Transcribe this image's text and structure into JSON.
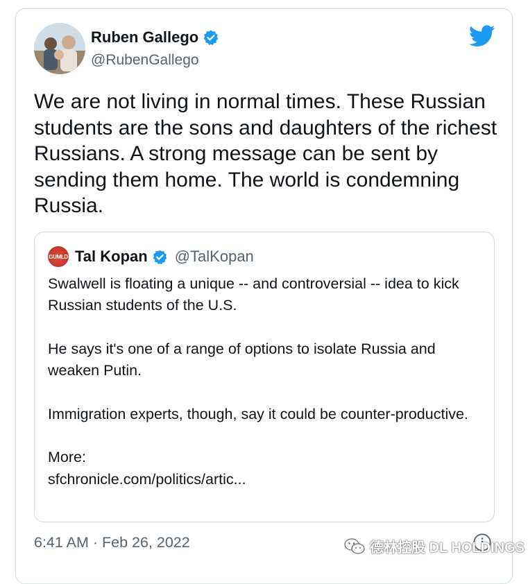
{
  "tweet": {
    "author_name": "Ruben Gallego",
    "author_handle": "@RubenGallego",
    "text": "We are not living in normal times. These Russian students are the sons and daughters of the richest Russians.  A strong message can be sent by sending them home. The world is condemning Russia.",
    "timestamp": "6:41 AM · Feb 26, 2022"
  },
  "quoted": {
    "avatar_text": "GUMLD",
    "author_name": "Tal Kopan",
    "author_handle": "@TalKopan",
    "paragraphs": [
      "Swalwell is floating a unique -- and controversial -- idea to kick Russian students of the U.S.",
      "He says it's one of a range of options to isolate Russia and weaken Putin.",
      "Immigration experts, though, say it could be counter-productive.",
      "More:",
      "sfchronicle.com/politics/artic..."
    ]
  },
  "watermark": {
    "text": "德林控股 DL HOLDINGS"
  },
  "colors": {
    "brand_blue": "#1d9bf0",
    "text_primary": "#0f1419",
    "text_secondary": "#536471",
    "border": "#cfd9de"
  },
  "icons": {
    "verified": "verified-badge-icon",
    "twitter": "twitter-bird-icon",
    "info": "info-icon",
    "wechat": "wechat-icon"
  }
}
